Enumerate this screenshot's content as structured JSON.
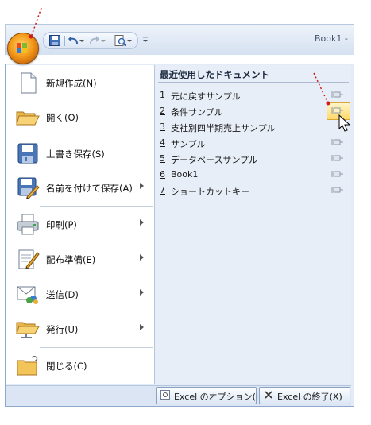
{
  "window": {
    "title": "Book1 -"
  },
  "quick_access": {
    "items": [
      {
        "icon": "save-icon"
      },
      {
        "icon": "undo-icon"
      },
      {
        "icon": "redo-icon"
      },
      {
        "icon": "print-preview-icon"
      }
    ],
    "customize_icon": "chevron-down-icon"
  },
  "menu": {
    "items": [
      {
        "label": "新規作成(N)",
        "icon": "new-document-icon",
        "submenu": false
      },
      {
        "label": "開く(O)",
        "icon": "open-folder-icon",
        "submenu": false
      },
      {
        "label": "上書き保存(S)",
        "icon": "save-icon",
        "submenu": false
      },
      {
        "label": "名前を付けて保存(A)",
        "icon": "save-as-icon",
        "submenu": true
      },
      {
        "label": "印刷(P)",
        "icon": "printer-icon",
        "submenu": true
      },
      {
        "label": "配布準備(E)",
        "icon": "prepare-icon",
        "submenu": true
      },
      {
        "label": "送信(D)",
        "icon": "send-icon",
        "submenu": true
      },
      {
        "label": "発行(U)",
        "icon": "publish-icon",
        "submenu": true
      },
      {
        "label": "閉じる(C)",
        "icon": "close-folder-icon",
        "submenu": false
      }
    ]
  },
  "recent": {
    "heading": "最近使用したドキュメント",
    "items": [
      {
        "num": "1",
        "name": "元に戻すサンプル"
      },
      {
        "num": "2",
        "name": "条件サンプル"
      },
      {
        "num": "3",
        "name": "支社別四半期売上サンプル"
      },
      {
        "num": "4",
        "name": "サンプル"
      },
      {
        "num": "5",
        "name": "データベースサンプル"
      },
      {
        "num": "6",
        "name": "Book1"
      },
      {
        "num": "7",
        "name": "ショートカットキー"
      }
    ]
  },
  "bottom": {
    "options_label": "Excel のオプション(I)",
    "exit_label": "Excel の終了(X)"
  },
  "colors": {
    "office_button": "#f39a1a",
    "annotation": "#d21a1a",
    "pin_highlight": "#ffd96a"
  }
}
